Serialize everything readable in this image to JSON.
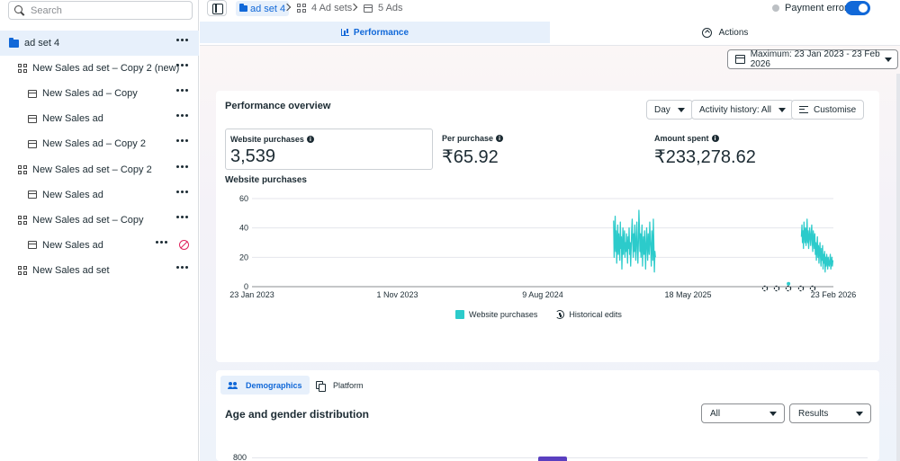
{
  "search": {
    "placeholder": "Search"
  },
  "tree": [
    {
      "label": "ad set 4",
      "icon": "folder-icon",
      "selected": true
    },
    {
      "label": "New Sales ad set – Copy 2 (new)",
      "icon": "grid-icon"
    },
    {
      "label": "New Sales ad – Copy",
      "icon": "ad-icon"
    },
    {
      "label": "New Sales ad",
      "icon": "ad-icon"
    },
    {
      "label": "New Sales ad – Copy 2",
      "icon": "ad-icon"
    },
    {
      "label": "New Sales ad set – Copy 2",
      "icon": "grid-icon"
    },
    {
      "label": "New Sales ad",
      "icon": "ad-icon"
    },
    {
      "label": "New Sales ad set – Copy",
      "icon": "grid-icon"
    },
    {
      "label": "New Sales ad",
      "icon": "ad-icon",
      "blocked": true
    },
    {
      "label": "New Sales ad set",
      "icon": "grid-icon"
    }
  ],
  "breadcrumb": {
    "current": "ad set 4",
    "ad_sets": "4 Ad sets",
    "ads": "5 Ads"
  },
  "status": {
    "payment_error": "Payment error",
    "toggle_on": true
  },
  "tabs": {
    "performance": "Performance",
    "actions": "Actions"
  },
  "date_range": "Maximum: 23 Jan 2023 - 23 Feb 2026",
  "performance": {
    "title": "Performance overview",
    "controls": {
      "granularity": "Day",
      "activity_history": "Activity history: All",
      "customise": "Customise"
    },
    "metrics": {
      "website_purchases": {
        "label": "Website purchases",
        "value": "3,539"
      },
      "per_purchase": {
        "label": "Per purchase",
        "value": "₹65.92"
      },
      "amount_spent": {
        "label": "Amount spent",
        "value": "₹233,278.62"
      }
    },
    "chart_title": "Website purchases",
    "legend": {
      "series": "Website purchases",
      "historical": "Historical edits"
    }
  },
  "colors": {
    "accent": "#1168d8",
    "series": "#2ccbcb",
    "error": "#e0245e"
  },
  "chart_data": {
    "type": "line",
    "ylabel": "",
    "xlabel": "",
    "ylim": [
      0,
      60
    ],
    "yticks": [
      0,
      20,
      40,
      60
    ],
    "xticks": [
      "23 Jan 2023",
      "1 Nov 2023",
      "9 Aug 2024",
      "18 May 2025",
      "23 Feb 2026"
    ],
    "x_range": [
      "2023-01-23",
      "2026-02-23"
    ],
    "series": [
      {
        "name": "Website purchases",
        "segments": [
          {
            "start": "2024-12-24",
            "values": [
              45,
              20,
              30,
              48,
              24,
              38,
              16,
              30,
              42,
              22,
              36,
              28,
              18,
              44,
              26,
              34,
              12,
              28,
              40,
              22,
              32,
              38,
              20,
              30,
              24,
              36,
              28,
              16,
              34,
              26,
              40,
              22,
              30,
              14,
              26,
              38,
              46,
              30,
              20,
              36,
              24,
              42,
              28,
              18,
              34,
              44,
              26,
              16,
              30,
              52,
              40,
              24,
              36,
              20,
              32,
              42,
              14,
              28,
              34,
              22,
              38,
              26,
              12,
              30,
              40,
              26,
              18,
              36,
              28,
              22,
              44,
              32,
              26,
              14,
              38,
              30,
              18,
              46,
              28,
              10,
              24,
              20
            ]
          },
          {
            "start": "2025-11-28",
            "values": [
              2
            ]
          },
          {
            "start": "2025-12-23",
            "values": [
              34,
              42,
              30,
              38,
              26,
              44,
              36,
              30,
              40,
              28,
              34,
              46,
              30,
              38,
              26,
              32,
              40,
              34,
              28,
              36,
              42,
              30,
              24,
              38,
              32,
              26,
              36,
              22,
              30,
              18,
              26,
              34,
              20,
              28,
              16,
              24,
              30,
              20,
              14,
              26,
              18,
              28,
              12,
              22,
              16,
              24,
              10,
              20,
              14,
              22,
              18,
              12,
              20,
              16,
              14,
              18,
              22,
              12,
              16,
              20,
              14,
              18
            ]
          }
        ]
      }
    ]
  },
  "demographics": {
    "tabs": {
      "demographics": "Demographics",
      "platform": "Platform"
    },
    "title": "Age and gender distribution",
    "filter_all": "All",
    "filter_results": "Results",
    "y_top": "800"
  }
}
